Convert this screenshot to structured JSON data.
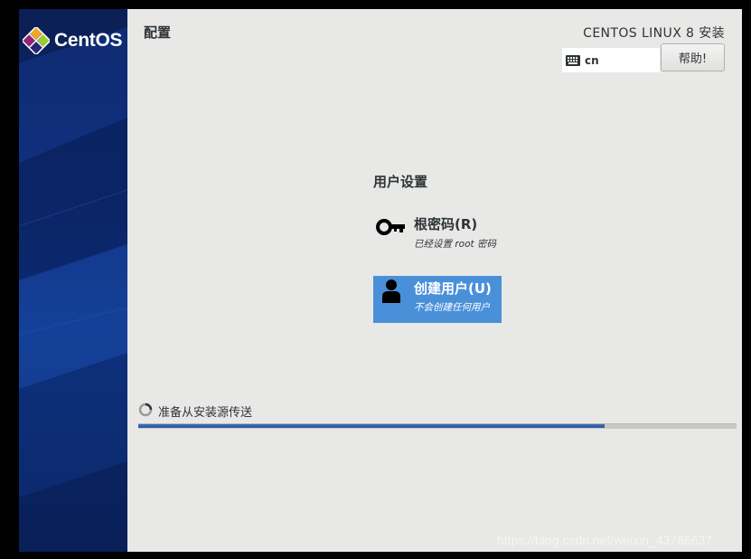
{
  "brand": {
    "name": "CentOS"
  },
  "header": {
    "spoke_title": "配置",
    "product_title": "CENTOS LINUX 8 安装",
    "keyboard_layout": "cn",
    "help_label": "帮助!"
  },
  "user_settings": {
    "section_title": "用户设置",
    "spokes": [
      {
        "name": "根密码(R)",
        "status": "已经设置 root 密码",
        "icon": "key-icon",
        "selected": false
      },
      {
        "name": "创建用户(U)",
        "status": "不会创建任何用户",
        "icon": "user-icon",
        "selected": true
      }
    ]
  },
  "progress": {
    "label": "准备从安装源传送",
    "fraction": 0.78
  },
  "watermark": "https://blog.csdn.net/weixin_43786637",
  "colors": {
    "accent_selected": "#4a90d9",
    "progress_fill": "#2a56a0",
    "sidebar": "#0d2c74",
    "background": "#e8e8e7"
  }
}
